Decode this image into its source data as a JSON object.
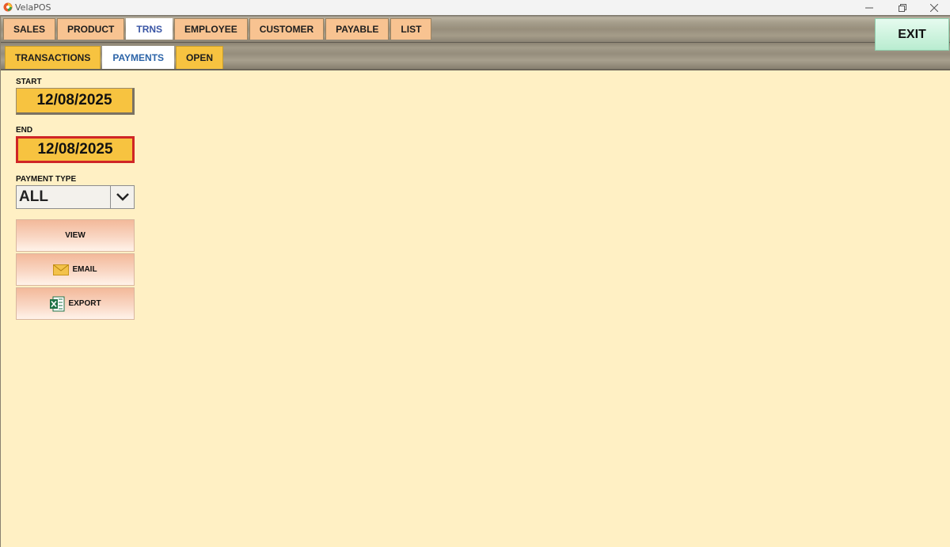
{
  "window": {
    "title": "VelaPOS"
  },
  "main_tabs": [
    "SALES",
    "PRODUCT",
    "TRNS",
    "EMPLOYEE",
    "CUSTOMER",
    "PAYABLE",
    "LIST"
  ],
  "active_main_tab": "TRNS",
  "sub_tabs": [
    "TRANSACTIONS",
    "PAYMENTS",
    "OPEN"
  ],
  "active_sub_tab": "PAYMENTS",
  "exit_label": "EXIT",
  "form": {
    "start_label": "START",
    "start_date": "12/08/2025",
    "end_label": "END",
    "end_date": "12/08/2025",
    "payment_type_label": "PAYMENT TYPE",
    "payment_type_value": "ALL"
  },
  "actions": {
    "view": "VIEW",
    "email": "EMAIL",
    "export": "EXPORT"
  },
  "icons": {
    "email": "envelope-icon",
    "export": "excel-icon",
    "dropdown": "chevron-down-icon"
  },
  "colors": {
    "background": "#fff0c4",
    "main_tab": "#f8c391",
    "sub_tab": "#f7c340",
    "date_field": "#f7c340",
    "end_field_border": "#d02626",
    "exit_button": "#c8f0da",
    "active_tab_text": "#3a56a5"
  }
}
